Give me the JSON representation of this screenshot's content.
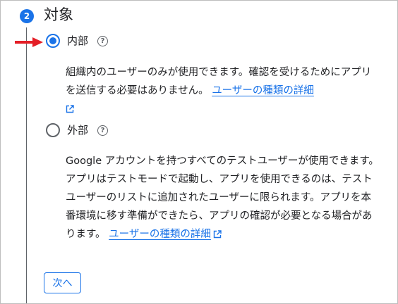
{
  "step": {
    "number": "2",
    "title": "対象"
  },
  "options": {
    "internal": {
      "label": "内部",
      "selected": true,
      "description": "組織内のユーザーのみが使用できます。確認を受けるためにアプリを送信する必要はありません。",
      "link_text": "ユーザーの種類の詳細"
    },
    "external": {
      "label": "外部",
      "selected": false,
      "description": "Google アカウントを持つすべてのテストユーザーが使用できます。アプリはテストモードで起動し、アプリを使用できるのは、テストユーザーのリストに追加されたユーザーに限られます。アプリを本番環境に移す準備ができたら、アプリの確認が必要となる場合があります。",
      "link_text": "ユーザーの種類の詳細"
    }
  },
  "buttons": {
    "next_label": "次へ"
  },
  "icons": {
    "help": "help-circle-icon",
    "external_link": "open-in-new-icon",
    "arrow": "red-arrow-icon"
  },
  "colors": {
    "accent": "#1a73e8",
    "annotation_arrow": "#e41e26",
    "text": "#202124"
  }
}
